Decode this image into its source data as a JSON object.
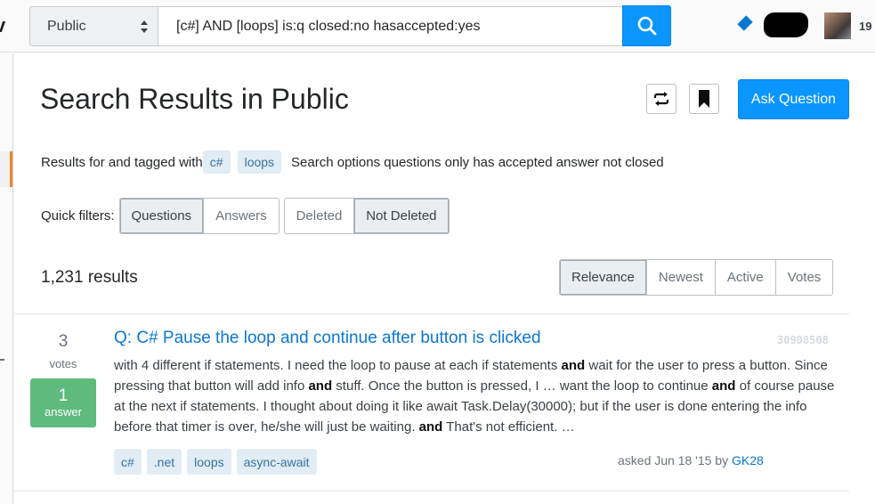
{
  "topbar": {
    "logo_fragment": "v",
    "scope_select": {
      "selected": "Public"
    },
    "search": {
      "value": "[c#] AND [loops] is:q closed:no hasaccepted:yes",
      "button_icon": "search-icon"
    },
    "user": {
      "rep_fragment": "19",
      "badge_icon": "diamond-icon"
    }
  },
  "header": {
    "title": "Search Results in Public",
    "ask_button": "Ask Question",
    "icon_buttons": [
      "repeat-icon",
      "bookmark-icon"
    ]
  },
  "description": {
    "prefix": "Results for and tagged with",
    "tags": [
      "c#",
      "loops"
    ],
    "suffix": "Search options questions only has accepted answer not closed"
  },
  "quick_filters": {
    "label": "Quick filters:",
    "group1": [
      {
        "label": "Questions",
        "selected": true
      },
      {
        "label": "Answers",
        "selected": false
      }
    ],
    "group2": [
      {
        "label": "Deleted",
        "selected": false
      },
      {
        "label": "Not Deleted",
        "selected": true
      }
    ]
  },
  "results": {
    "count_text": "1,231 results",
    "sort_options": [
      {
        "label": "Relevance",
        "selected": true
      },
      {
        "label": "Newest",
        "selected": false
      },
      {
        "label": "Active",
        "selected": false
      },
      {
        "label": "Votes",
        "selected": false
      }
    ],
    "items": [
      {
        "votes": "3",
        "votes_label": "votes",
        "answers": "1",
        "answers_label": "answer",
        "title": "Q: C# Pause the loop and continue after button is clicked",
        "id": "30908508",
        "excerpt": [
          {
            "t": "with 4 different if statements. I need the loop to pause at each if statements "
          },
          {
            "t": "and",
            "b": true
          },
          {
            "t": " wait for the user to press a button. Since pressing that button will add info "
          },
          {
            "t": "and",
            "b": true
          },
          {
            "t": " stuff. Once the button is pressed, I … want the loop to continue "
          },
          {
            "t": "and",
            "b": true
          },
          {
            "t": " of course pause at the next if statements. I thought about doing it like await Task.Delay(30000); but if the user is done entering the info before that timer is over, he/she will just be waiting. "
          },
          {
            "t": "and",
            "b": true
          },
          {
            "t": " That's not efficient. …"
          }
        ],
        "tags": [
          "c#",
          ".net",
          "loops",
          "async-await"
        ],
        "asked_text": "asked Jun 18 '15 by",
        "author": "GK28"
      }
    ]
  },
  "colors": {
    "accent": "#0a95ff",
    "link": "#0a78d1",
    "accepted_green": "#5eba7d",
    "nav_active": "#f48024",
    "tag_bg": "#e1ecf4",
    "tag_text": "#39739d"
  }
}
